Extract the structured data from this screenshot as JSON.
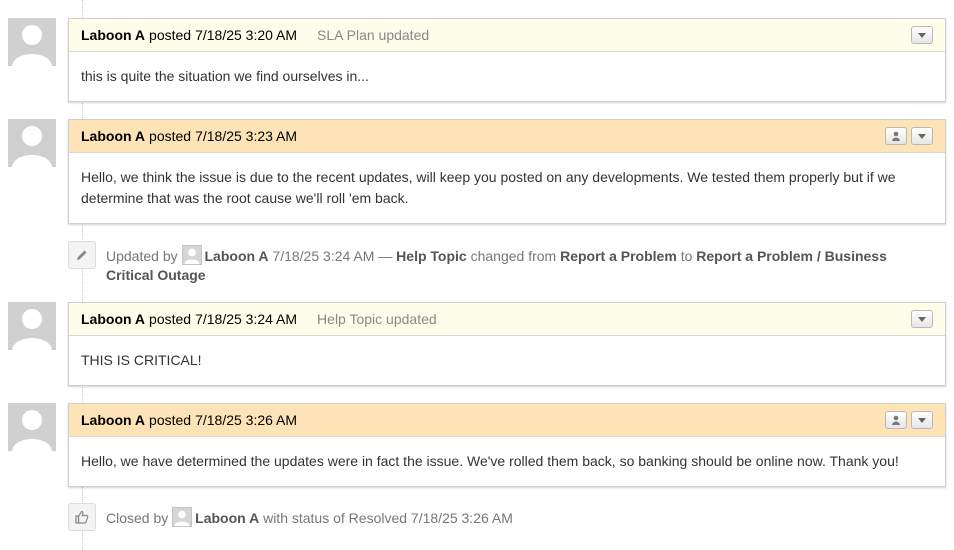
{
  "threads": [
    {
      "poster": "Laboon A",
      "posted_word": "posted",
      "time": "7/18/25 3:20 AM",
      "title": "SLA Plan updated",
      "body": "this is quite the situation we find ourselves in...",
      "header_color": "#fefde9"
    },
    {
      "poster": "Laboon A",
      "posted_word": "posted",
      "time": "7/18/25 3:23 AM",
      "title": "",
      "body": "Hello, we think the issue is due to the recent updates, will keep you posted on any developments. We tested them properly but if we determine that was the root cause we'll roll 'em back.",
      "header_color": "#fde3b6"
    },
    {
      "poster": "Laboon A",
      "posted_word": "posted",
      "time": "7/18/25 3:24 AM",
      "title": "Help Topic updated",
      "body": "THIS IS CRITICAL!",
      "header_color": "#fefde9"
    },
    {
      "poster": "Laboon A",
      "posted_word": "posted",
      "time": "7/18/25 3:26 AM",
      "title": "",
      "body": "Hello, we have determined the updates were in fact the issue. We've rolled them back, so banking should be online now. Thank you!",
      "header_color": "#fde3b6"
    }
  ],
  "events": {
    "update": {
      "icon": "pencil-icon",
      "prefix": "Updated by",
      "user": "Laboon A",
      "time": "7/18/25 3:24 AM —",
      "field": "Help Topic",
      "changed_from": "changed from",
      "from_value": "Report a Problem",
      "to_word": "to",
      "to_value": "Report a Problem / Business Critical Outage"
    },
    "closed": {
      "icon": "thumbs-up-icon",
      "prefix": "Closed by",
      "user": "Laboon A",
      "suffix": "with status of Resolved 7/18/25 3:26 AM"
    }
  }
}
